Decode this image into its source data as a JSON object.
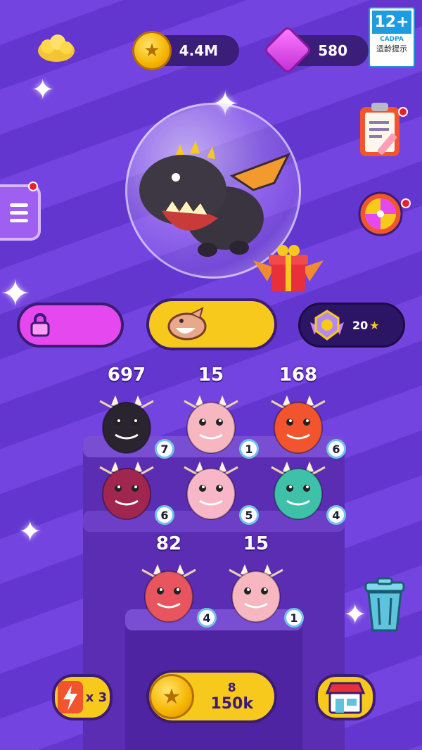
{
  "hud": {
    "coins": "4.4M",
    "gems": "580",
    "age_rating": {
      "number": "12+",
      "org": "CADPA",
      "tip": "适龄提示"
    }
  },
  "board": {
    "tiles": [
      {
        "score": "697",
        "level": "7",
        "color": "#2a2330"
      },
      {
        "score": "15",
        "level": "1",
        "color": "#f6b7c1"
      },
      {
        "score": "168",
        "level": "6",
        "color": "#f2542d"
      },
      {
        "score": "",
        "level": "6",
        "color": "#a0254f"
      },
      {
        "score": "",
        "level": "5",
        "color": "#f7b7c8"
      },
      {
        "score": "",
        "level": "4",
        "color": "#3fc0a8"
      },
      {
        "score": "82",
        "level": "4",
        "color": "#e8555f"
      },
      {
        "score": "15",
        "level": "1",
        "color": "#f6b7c1"
      }
    ]
  },
  "rank": {
    "stars": "20"
  },
  "bottom": {
    "boost_multiplier": "x 3",
    "buy_count": "8",
    "buy_price": "150k"
  },
  "colors": {
    "background": "#6b3fd8",
    "yellow": "#f7c91c",
    "magenta": "#e648ef",
    "dark_outline": "#3c1b72"
  }
}
